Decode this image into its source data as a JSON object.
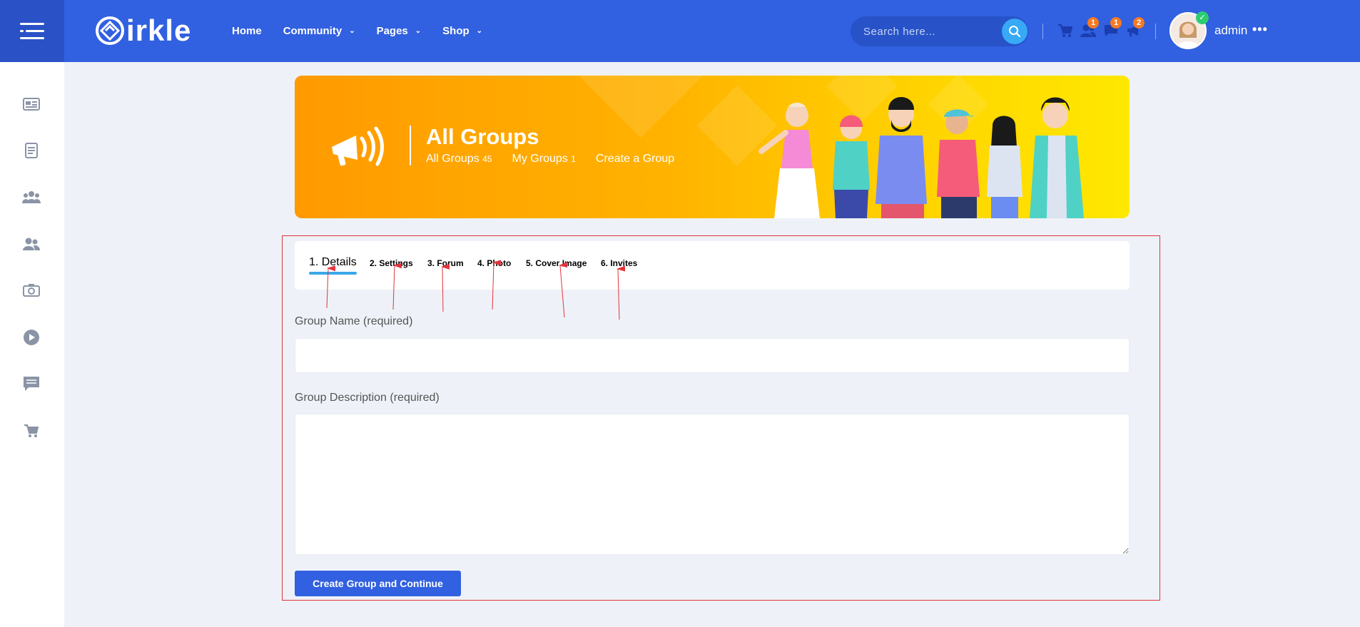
{
  "brand": {
    "logo_text": "irkle"
  },
  "nav": {
    "home": "Home",
    "community": "Community",
    "pages": "Pages",
    "shop": "Shop"
  },
  "search": {
    "placeholder": "Search here..."
  },
  "notifications": {
    "friends": "1",
    "messages": "1",
    "alerts": "2"
  },
  "user": {
    "name": "admin"
  },
  "sidebar": {
    "items": [
      "newsfeed-icon",
      "notes-icon",
      "groups-icon",
      "friends-icon",
      "photos-icon",
      "videos-icon",
      "forum-icon",
      "cart-icon"
    ]
  },
  "banner": {
    "title": "All Groups",
    "links": [
      {
        "label": "All Groups",
        "count": "45"
      },
      {
        "label": "My Groups",
        "count": "1"
      },
      {
        "label": "Create a Group",
        "count": ""
      }
    ]
  },
  "tabs": [
    "1. Details",
    "2. Settings",
    "3. Forum",
    "4. Photo",
    "5. Cover Image",
    "6. Invites"
  ],
  "form": {
    "name_label": "Group Name (required)",
    "name_value": "",
    "desc_label": "Group Description (required)",
    "desc_value": "",
    "submit_label": "Create Group and Continue"
  },
  "colors": {
    "primary": "#3160e0",
    "primary_dark": "#2a52c6",
    "accent": "#38a9f6",
    "badge": "#f47a24",
    "annotation": "#e2333b"
  }
}
